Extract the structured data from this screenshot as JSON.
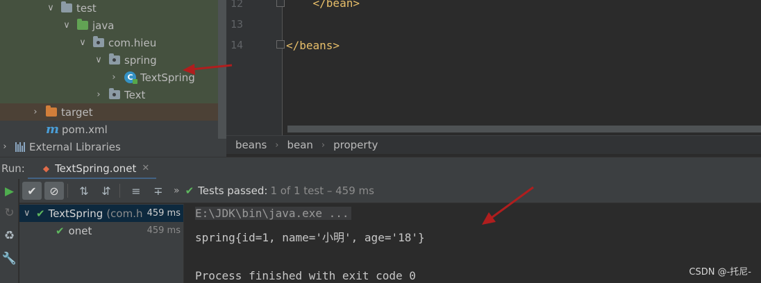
{
  "project_tree": {
    "items": [
      {
        "label": "test",
        "icon": "folder-icon"
      },
      {
        "label": "java",
        "icon": "source-folder-icon"
      },
      {
        "label": "com.hieu",
        "icon": "package-icon"
      },
      {
        "label": "spring",
        "icon": "package-icon"
      },
      {
        "label": "TextSpring",
        "icon": "java-class-icon"
      },
      {
        "label": "Text",
        "icon": "package-icon"
      },
      {
        "label": "target",
        "icon": "excluded-folder-icon"
      },
      {
        "label": "pom.xml",
        "icon": "maven-icon"
      },
      {
        "label": "External Libraries",
        "icon": "library-icon"
      }
    ],
    "class_glyph": "C",
    "maven_glyph": "m"
  },
  "editor": {
    "lines": [
      {
        "num": "12",
        "code": "    </bean>"
      },
      {
        "num": "13",
        "code": ""
      },
      {
        "num": "14",
        "code": "</beans>"
      }
    ]
  },
  "breadcrumb": [
    "beans",
    "bean",
    "property"
  ],
  "run_panel": {
    "label": "Run:",
    "tab_label": "TextSpring.onet",
    "status_main": "Tests passed:",
    "status_detail": "1 of 1 test – 459 ms",
    "tree": [
      {
        "name": "TextSpring",
        "pkg": "(com.h",
        "time": "459 ms"
      },
      {
        "name": "onet",
        "time": "459 ms"
      }
    ],
    "console": [
      "E:\\JDK\\bin\\java.exe ...",
      "spring{id=1, name='小明', age='18'}",
      "",
      "Process finished with exit code 0"
    ]
  },
  "watermark": "CSDN @-托尼-",
  "colors": {
    "accent_blue": "#4a88c7",
    "pass_green": "#5fb85f",
    "annotation_arrow": "#b01e1e",
    "tag_yellow": "#e8bf6a"
  }
}
